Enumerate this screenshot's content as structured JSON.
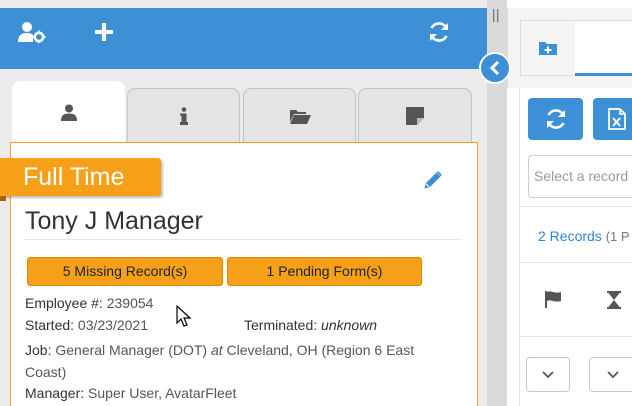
{
  "toolbar": {
    "icons": [
      "user-cog-icon",
      "plus-icon",
      "refresh-icon"
    ],
    "color": "#3d8fd6"
  },
  "tabs": [
    {
      "icon": "user-icon",
      "active": true
    },
    {
      "icon": "info-icon",
      "active": false
    },
    {
      "icon": "folder-open-icon",
      "active": false
    },
    {
      "icon": "sticky-note-icon",
      "active": false
    }
  ],
  "employee": {
    "status_ribbon": "Full Time",
    "name": "Tony J Manager",
    "missing_records": "5 Missing Record(s)",
    "pending_forms": "1 Pending Form(s)",
    "employee_number_label": "Employee #:",
    "employee_number": "239054",
    "started_label": "Started:",
    "started": "03/23/2021",
    "terminated_label": "Terminated:",
    "terminated": "unknown",
    "job_label": "Job:",
    "job_title": "General Manager (DOT)",
    "job_at": "at",
    "job_location": "Cleveland, OH (Region 6 East Coast)",
    "manager_label": "Manager:",
    "manager": "Super User, AvatarFleet"
  },
  "right_panel": {
    "search_placeholder": "Select a record",
    "records_count": "2 Records",
    "records_pages": "(1 P"
  },
  "colors": {
    "accent": "#3d8fd6",
    "orange": "#f6a01a"
  }
}
